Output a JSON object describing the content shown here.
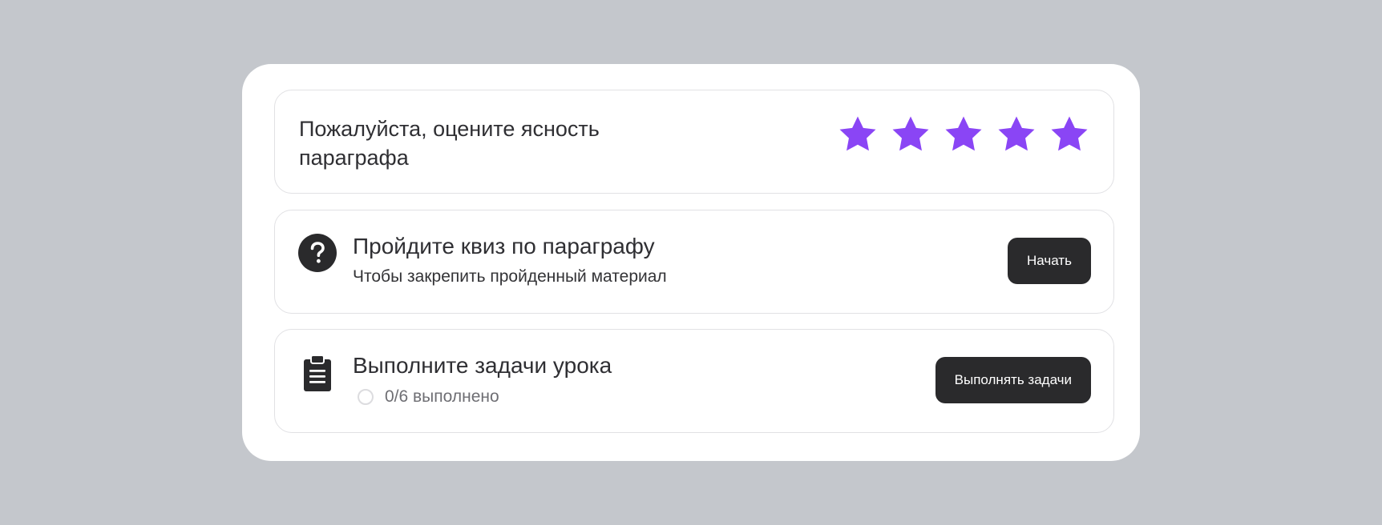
{
  "rating": {
    "question": "Пожалуйста, оцените ясность параграфа",
    "stars": [
      {
        "name": "star-1",
        "filled": true
      },
      {
        "name": "star-2",
        "filled": true
      },
      {
        "name": "star-3",
        "filled": true
      },
      {
        "name": "star-4",
        "filled": true
      },
      {
        "name": "star-5",
        "filled": true
      }
    ],
    "star_color": "#8a45f5"
  },
  "quiz": {
    "icon": "question-circle-icon",
    "title": "Пройдите квиз по параграфу",
    "subtitle": "Чтобы закрепить пройденный материал",
    "button_label": "Начать"
  },
  "tasks": {
    "icon": "clipboard-icon",
    "title": "Выполните задачи урока",
    "progress_text": "0/6 выполнено",
    "button_label": "Выполнять задачи"
  },
  "colors": {
    "background": "#c4c7cc",
    "card": "#ffffff",
    "button": "#2a2a2c",
    "text": "#2f2f33"
  }
}
